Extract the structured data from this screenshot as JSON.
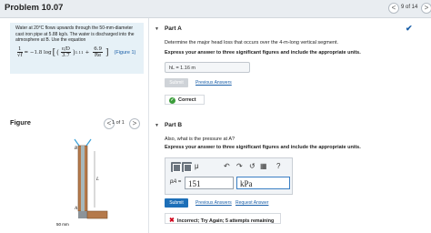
{
  "header": {
    "title": "Problem 10.07",
    "page_indicator": "9 of 14",
    "prev": "<",
    "next": ">"
  },
  "problem": {
    "statement": "Water at 20°C flows upwards through the 50-mm-diameter cast iron pipe at 5.88 kg/s. The water is discharged into the atmosphere at B. Use the equation",
    "equation_lhs_num": "1",
    "equation_lhs_den": "√f",
    "equation_mid": "= −1.8 log",
    "equation_term1_num": "ε/D",
    "equation_term1_den": "3.7",
    "equation_exp": "1.11",
    "equation_plus": "+",
    "equation_term2_num": "6.9",
    "equation_term2_den": "Re",
    "figure_link": "(Figure 1)"
  },
  "figure_panel": {
    "label": "Figure",
    "count": "1 of 1",
    "prev": "<",
    "next": ">",
    "pipe_label_B": "B",
    "pipe_label_A": "A",
    "pipe_label_L": "L",
    "diameter_label": "50 mm"
  },
  "partA": {
    "title": "Part A",
    "question": "Determine the major head loss that occurs over the 4-m-long vertical segment.",
    "instruction": "Express your answer to three significant figures and include the appropriate units.",
    "answer": "hL = 1.16 m",
    "submit_label": "Submit",
    "prev_answers_label": "Previous Answers",
    "feedback": "Correct"
  },
  "partB": {
    "title": "Part B",
    "question": "Also, what is the pressure at A?",
    "instruction": "Express your answer to three significant figures and include the appropriate units.",
    "var_label": "pA =",
    "value": "151",
    "unit": "kPa",
    "submit_label": "Submit",
    "prev_answers_label": "Previous Answers",
    "request_answer_label": "Request Answer",
    "feedback": "Incorrect; Try Again; 5 attempts remaining",
    "toolbar_glyphs": [
      "μ",
      "↶",
      "↷",
      "↺",
      "▦",
      "?"
    ]
  },
  "colors": {
    "accent": "#1d6fb8",
    "correct": "#3b9d3a",
    "incorrect": "#d0021b",
    "statement_bg": "#e6f1f7"
  }
}
